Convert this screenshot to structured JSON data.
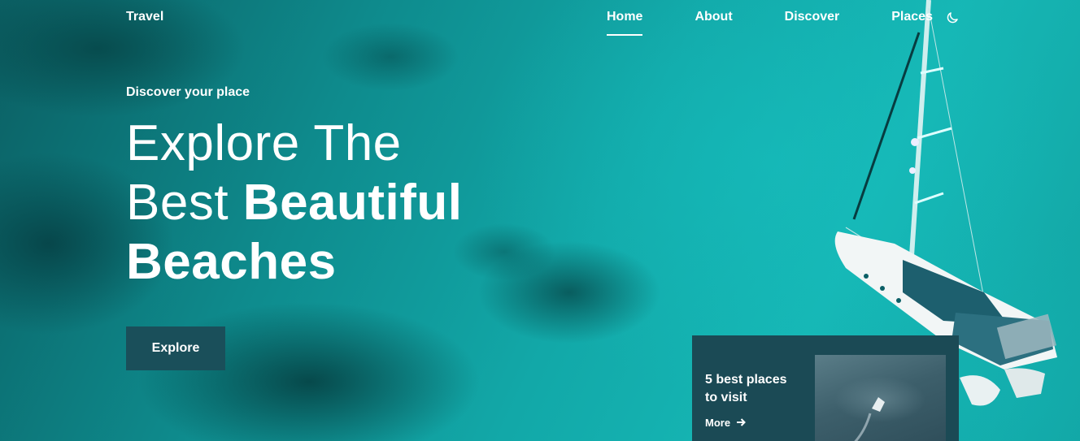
{
  "header": {
    "logo": "Travel",
    "nav": [
      "Home",
      "About",
      "Discover",
      "Places"
    ],
    "active": "Home"
  },
  "hero": {
    "subtitle": "Discover your place",
    "headline_line1": "Explore The",
    "headline_line2_light": "Best ",
    "headline_line2_bold": "Beautiful",
    "headline_line3": "Beaches",
    "button": "Explore"
  },
  "card": {
    "title": "5 best places to visit",
    "more": "More",
    "more_icon": "arrow-right-icon"
  },
  "icons": {
    "theme": "moon-icon"
  },
  "colors": {
    "button_bg": "#1a4f5a",
    "card_bg": "#1b4a55",
    "text": "#ffffff"
  }
}
